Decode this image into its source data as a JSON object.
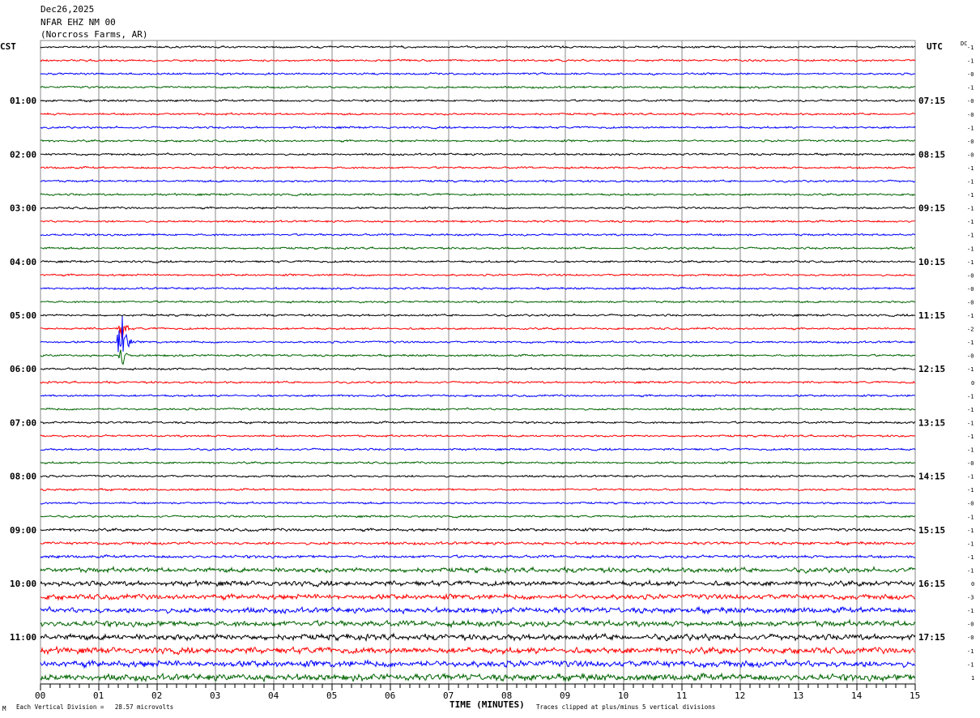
{
  "header": {
    "date": "Dec26,2025",
    "station": "NFAR EHZ NM 00",
    "location": "(Norcross Farms, AR)"
  },
  "chart_data": {
    "type": "line",
    "subtype": "helicorder",
    "left_axis_title": "CST",
    "right_axis_title": "UTC",
    "dc_title": "DC",
    "xlabel": "TIME (MINUTES)",
    "xlim": [
      0,
      15
    ],
    "x_ticks": [
      "00",
      "01",
      "02",
      "03",
      "04",
      "05",
      "06",
      "07",
      "08",
      "09",
      "10",
      "11",
      "12",
      "13",
      "14",
      "15"
    ],
    "rows": 48,
    "minutes_per_row": 15,
    "trace_colors": [
      "#000000",
      "#ff0000",
      "#0000ff",
      "#006400"
    ],
    "left_labels": [
      "",
      "01:00",
      "02:00",
      "03:00",
      "04:00",
      "05:00",
      "06:00",
      "07:00",
      "08:00",
      "09:00",
      "10:00",
      "11:00"
    ],
    "right_labels": [
      "",
      "07:15",
      "08:15",
      "09:15",
      "10:15",
      "11:15",
      "12:15",
      "13:15",
      "14:15",
      "15:15",
      "16:15",
      "17:15"
    ],
    "dc_offsets": [
      "-1",
      "-1",
      "-0",
      "-1",
      "-0",
      "-0",
      "-1",
      "-0",
      "-0",
      "-1",
      "-1",
      "-1",
      "-1",
      "-1",
      "-1",
      "-1",
      "-1",
      "-0",
      "-0",
      "-0",
      "-1",
      "-2",
      "-1",
      "-0",
      "-1",
      "0",
      "-1",
      "-1",
      "-1",
      "-1",
      "-1",
      "-0",
      "-1",
      "-1",
      "-0",
      "-1",
      "-1",
      "-1",
      "-1",
      "-1",
      "0",
      "-3",
      "-1",
      "-0",
      "-0",
      "-1",
      "-1",
      "1"
    ],
    "events": [
      {
        "row": 22,
        "minute": 1.4,
        "description": "large local event"
      }
    ],
    "scale_note": "Each Vertical Division =   28.57 microvolts",
    "clip_note": "Traces clipped at plus/minus 5 vertical divisions",
    "grid": true
  },
  "footer": {
    "corner_mark": "M"
  }
}
